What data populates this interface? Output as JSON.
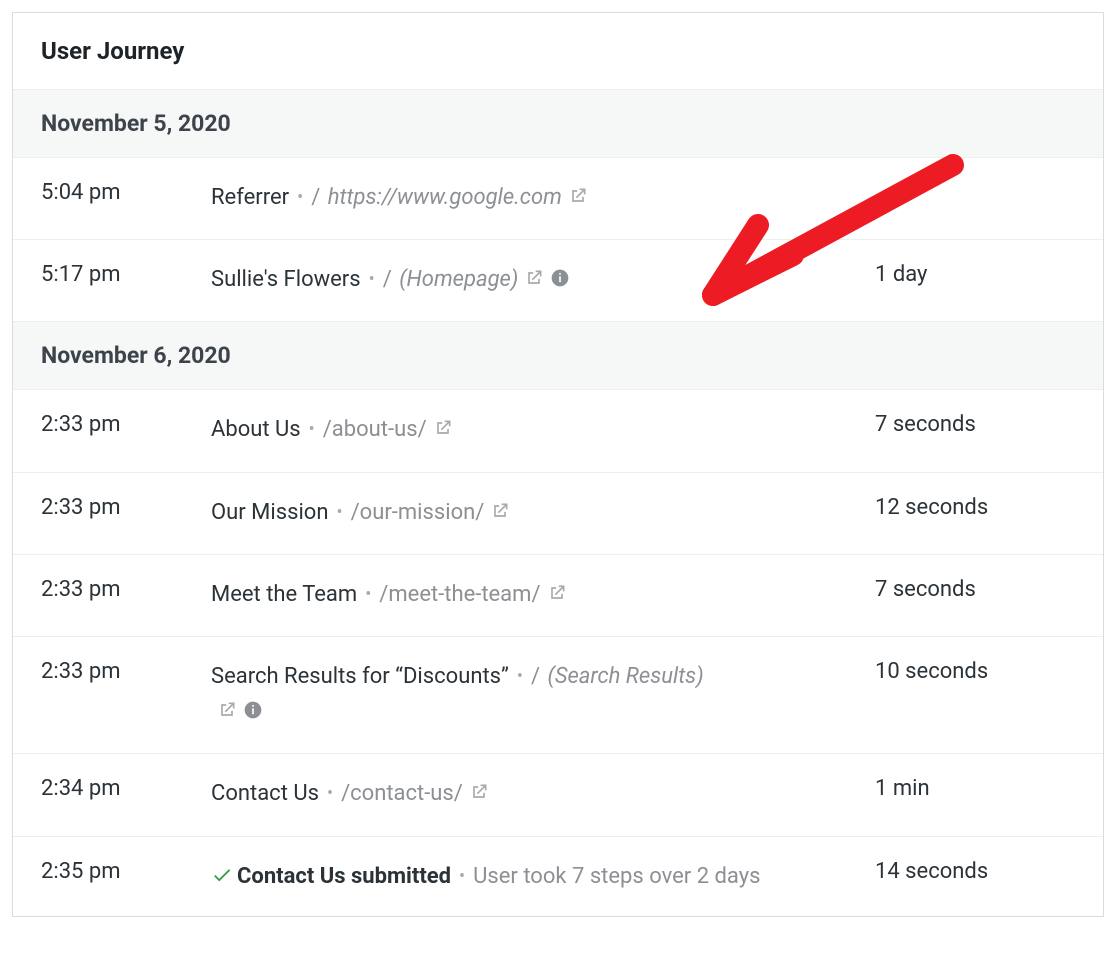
{
  "header": {
    "title": "User Journey"
  },
  "groups": [
    {
      "date": "November 5, 2020",
      "rows": [
        {
          "time": "5:04 pm",
          "title": "Referrer",
          "path": "https://www.google.com",
          "path_italic": true,
          "path_parens": false,
          "has_external": true,
          "has_info": false,
          "has_check": false,
          "duration": "",
          "is_summary": false
        },
        {
          "time": "5:17 pm",
          "title": "Sullie's Flowers",
          "path": "(Homepage)",
          "path_italic": true,
          "path_parens": true,
          "has_external": true,
          "has_info": true,
          "has_check": false,
          "duration": "1 day",
          "is_summary": false,
          "has_annotation_arrow": true
        }
      ]
    },
    {
      "date": "November 6, 2020",
      "rows": [
        {
          "time": "2:33 pm",
          "title": "About Us",
          "path": "/about-us/",
          "path_italic": false,
          "path_parens": false,
          "has_external": true,
          "has_info": false,
          "has_check": false,
          "duration": "7 seconds",
          "is_summary": false
        },
        {
          "time": "2:33 pm",
          "title": "Our Mission",
          "path": "/our-mission/",
          "path_italic": false,
          "path_parens": false,
          "has_external": true,
          "has_info": false,
          "has_check": false,
          "duration": "12 seconds",
          "is_summary": false
        },
        {
          "time": "2:33 pm",
          "title": "Meet the Team",
          "path": "/meet-the-team/",
          "path_italic": false,
          "path_parens": false,
          "has_external": true,
          "has_info": false,
          "has_check": false,
          "duration": "7 seconds",
          "is_summary": false
        },
        {
          "time": "2:33 pm",
          "title": "Search Results for “Discounts”",
          "path": "(Search Results)",
          "path_italic": true,
          "path_parens": true,
          "has_external": true,
          "has_info": true,
          "has_check": false,
          "duration": "10 seconds",
          "is_summary": false,
          "icons_on_newline": true
        },
        {
          "time": "2:34 pm",
          "title": "Contact Us",
          "path": "/contact-us/",
          "path_italic": false,
          "path_parens": false,
          "has_external": true,
          "has_info": false,
          "has_check": false,
          "duration": "1 min",
          "is_summary": false
        },
        {
          "time": "2:35 pm",
          "title": "Contact Us submitted",
          "summary": "User took 7 steps over 2 days",
          "has_external": false,
          "has_info": false,
          "has_check": true,
          "duration": "14 seconds",
          "is_summary": true
        }
      ]
    }
  ],
  "icons": {
    "external": "external-link-icon",
    "info": "info-icon",
    "check": "checkmark-icon"
  }
}
